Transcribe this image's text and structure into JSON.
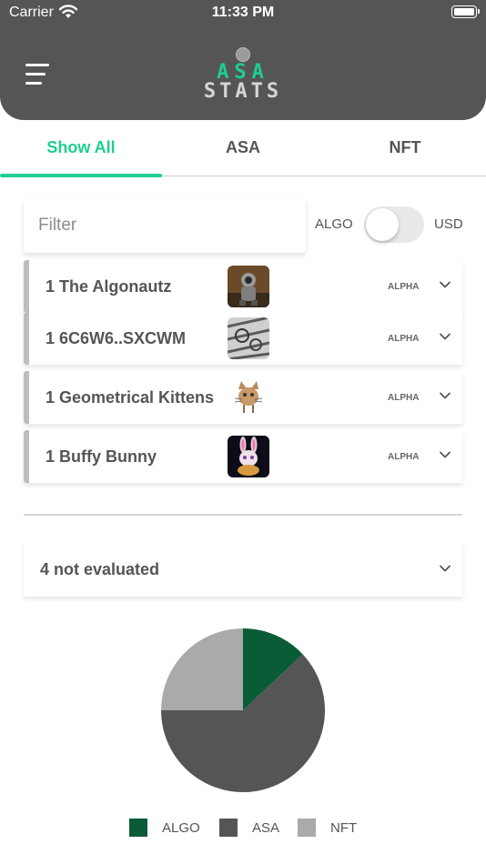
{
  "status_bar": {
    "carrier": "Carrier",
    "time": "11:33 PM"
  },
  "header": {
    "logo_line1": "ASA",
    "logo_line2": "STATS"
  },
  "tabs": [
    {
      "label": "Show All",
      "active": true
    },
    {
      "label": "ASA",
      "active": false
    },
    {
      "label": "NFT",
      "active": false
    }
  ],
  "filter": {
    "placeholder": "Filter",
    "value": ""
  },
  "currency_toggle": {
    "left_label": "ALGO",
    "right_label": "USD",
    "selected": "ALGO"
  },
  "items": [
    {
      "name": "1 The Algonautz",
      "tag": "ALPHA",
      "thumb_icon": "astronaut-nft-thumbnail"
    },
    {
      "name": "1 6C6W6..SXCWM",
      "tag": "ALPHA",
      "thumb_icon": "mechanical-nft-thumbnail"
    },
    {
      "name": "1 Geometrical Kittens",
      "tag": "ALPHA",
      "thumb_icon": "kitten-nft-thumbnail"
    },
    {
      "name": "1 Buffy Bunny",
      "tag": "ALPHA",
      "thumb_icon": "bunny-nft-thumbnail"
    }
  ],
  "not_evaluated": {
    "label": "4 not evaluated"
  },
  "chart_data": {
    "type": "pie",
    "labels": [
      "ALGO",
      "ASA",
      "NFT"
    ],
    "values": [
      13,
      62,
      25
    ],
    "colors": [
      "#0a5c36",
      "#555555",
      "#aaaaaa"
    ],
    "legend_position": "bottom"
  },
  "colors": {
    "accent": "#1fce8e",
    "header_bg": "#555555"
  }
}
